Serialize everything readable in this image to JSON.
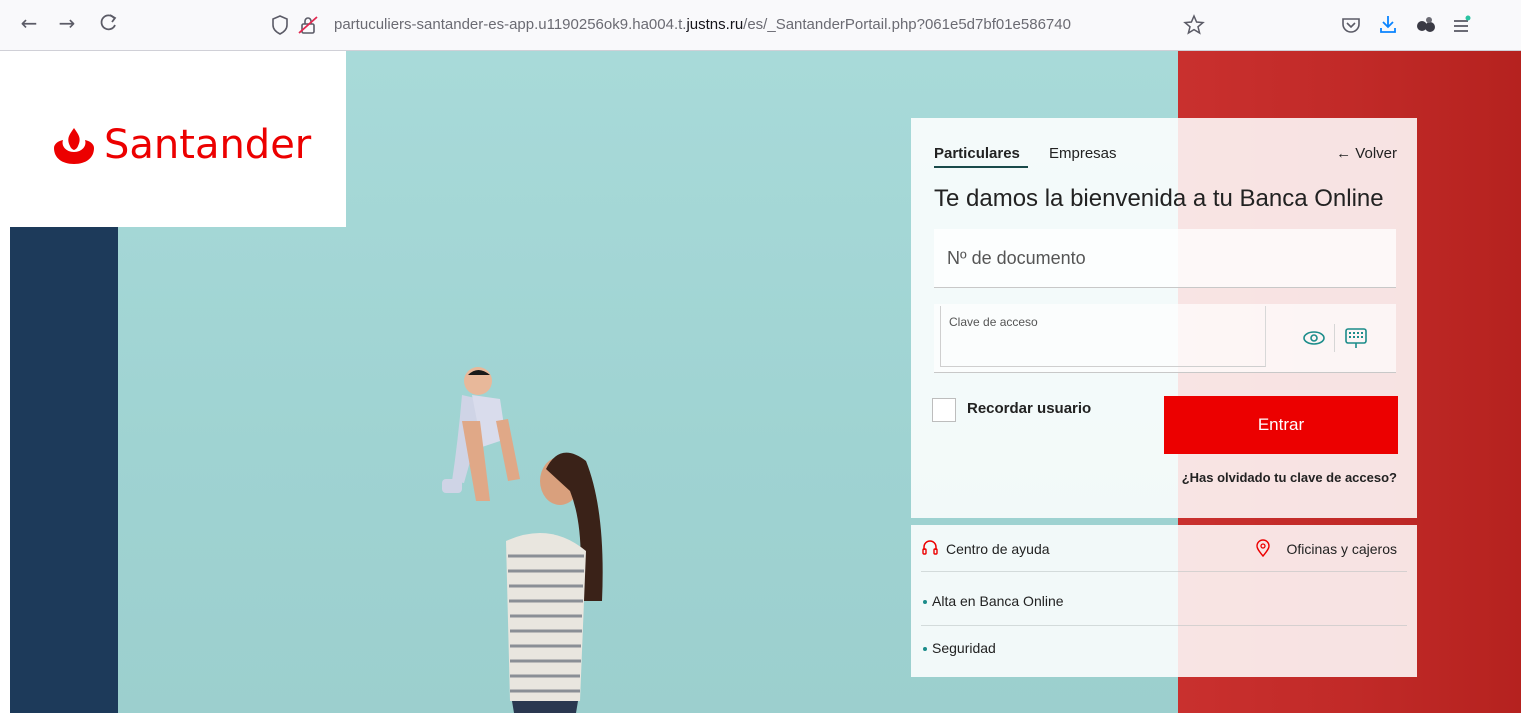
{
  "browser": {
    "url_prefix": "partuculiers-santander-es-app.u1190256ok9.ha004.t.",
    "url_domain": "justns.ru",
    "url_suffix": "/es/_SantanderPortail.php?061e5d7bf01e586740",
    "icons": [
      "back-arrow-icon",
      "forward-arrow-icon",
      "reload-icon",
      "shield-icon",
      "lock-warning-icon",
      "bookmark-star-icon",
      "pocket-icon",
      "download-icon",
      "extensions-icon",
      "menu-icon"
    ]
  },
  "brand": {
    "name": "Santander",
    "color": "#ec0000"
  },
  "login": {
    "tab_particulares": "Particulares",
    "tab_empresas": "Empresas",
    "back_label": "← Volver",
    "welcome": "Te damos la bienvenida a tu Banca Online",
    "doc_placeholder": "Nº de documento",
    "password_label": "Clave de acceso",
    "remember_label": "Recordar usuario",
    "submit_label": "Entrar",
    "forgot_label": "¿Has olvidado tu clave de acceso?"
  },
  "links": {
    "help": "Centro de ayuda",
    "offices": "Oficinas y cajeros",
    "items": [
      "Alta en Banca Online",
      "Seguridad"
    ]
  },
  "colors": {
    "accent": "#ec0000",
    "teal_bg": "#a8dad9",
    "navy": "#1d3a5a"
  }
}
